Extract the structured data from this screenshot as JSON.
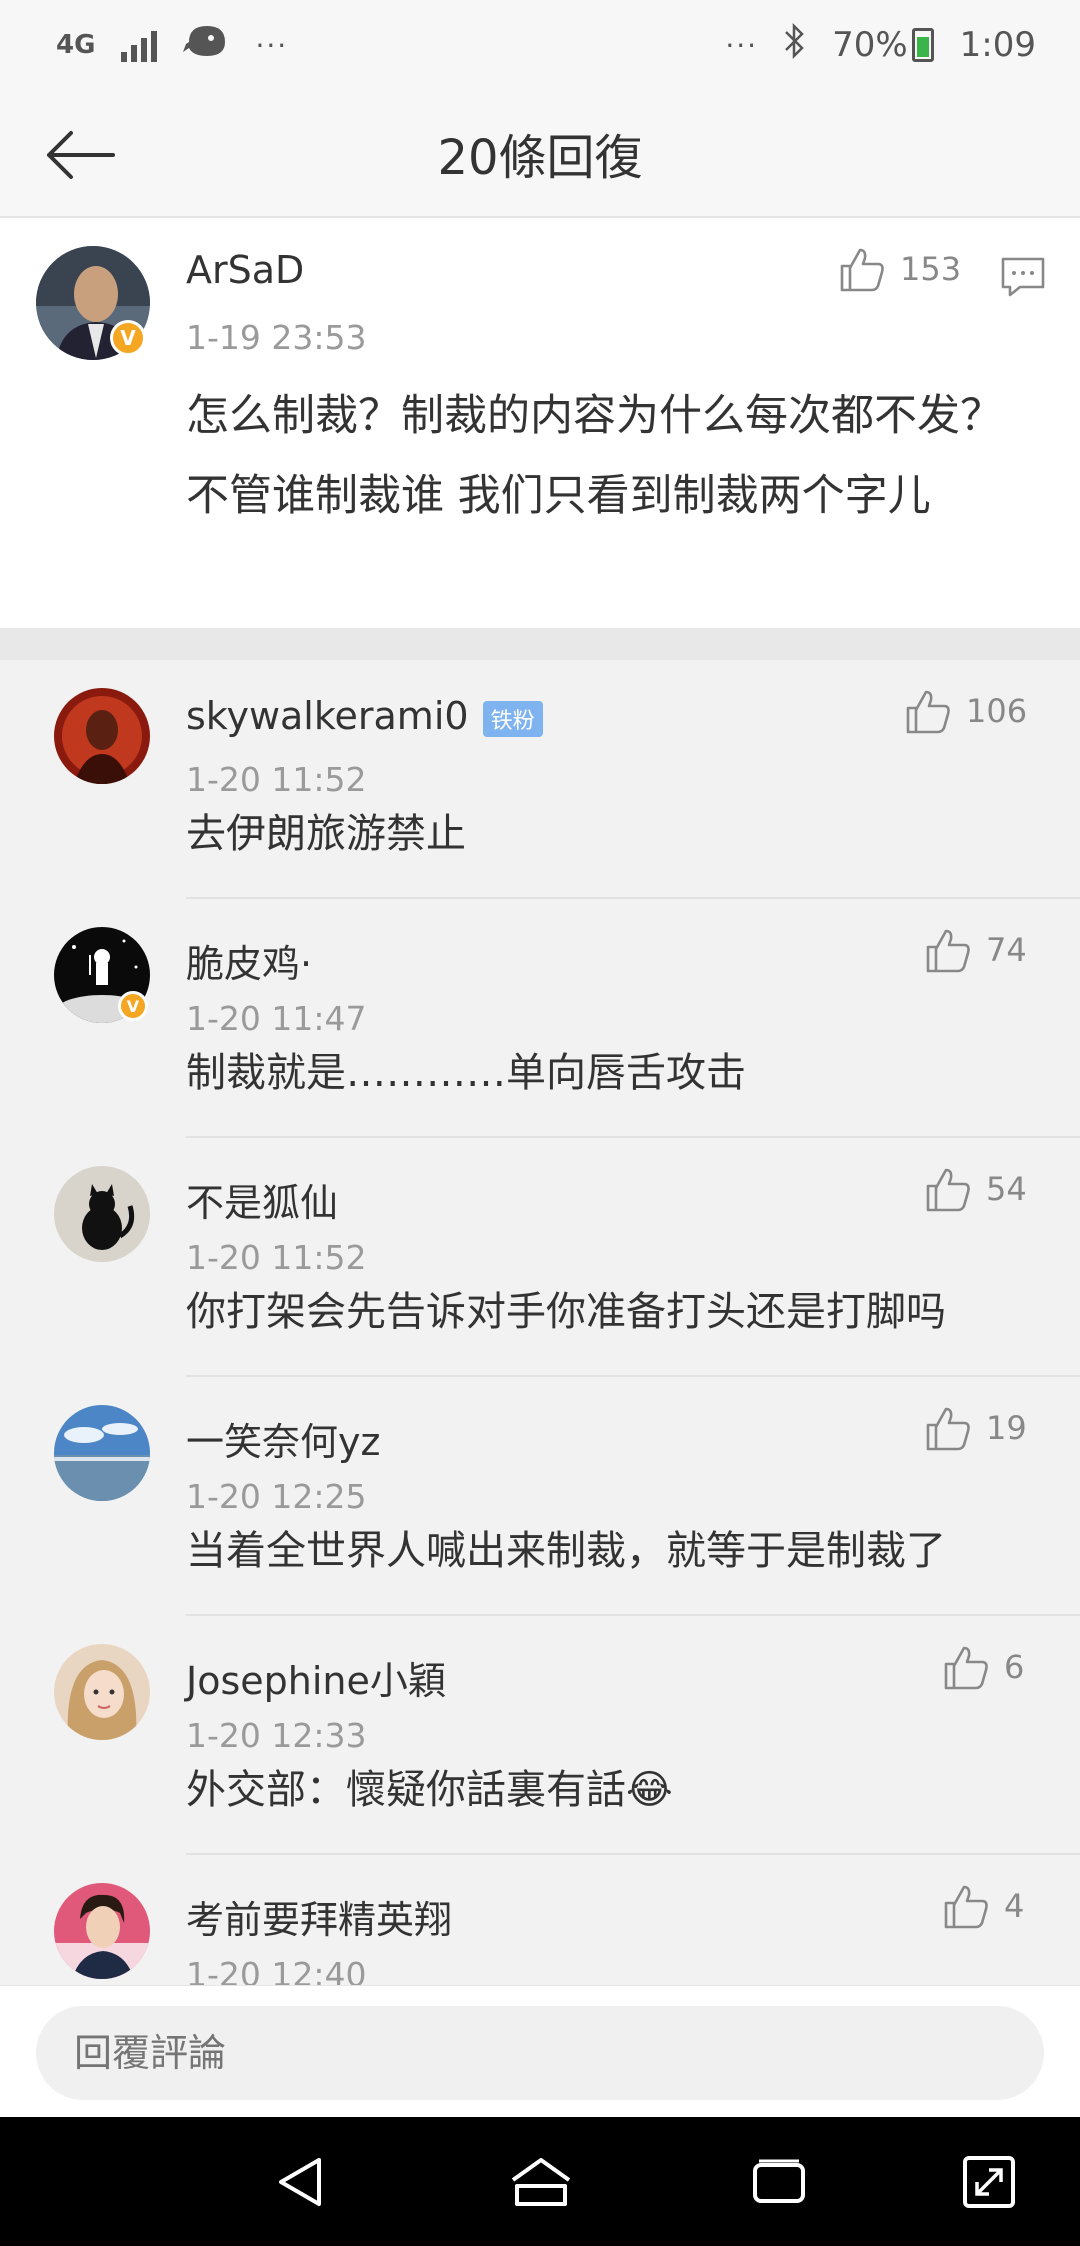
{
  "status_bar": {
    "network": "4G",
    "left_dots": "···",
    "right_dots": "···",
    "battery": "70%",
    "time": "1:09"
  },
  "header": {
    "title": "20條回復",
    "back_icon": "back-arrow-icon"
  },
  "main_post": {
    "username": "ArSaD",
    "time": "1-19 23:53",
    "likes": "153",
    "content": "怎么制裁？制裁的内容为什么每次都不发？不管谁制裁谁 我们只看到制裁两个字儿",
    "verified": true
  },
  "replies": [
    {
      "username": "skywalkerami0",
      "badge": "铁粉",
      "time": "1-20 11:52",
      "likes": "106",
      "content": "去伊朗旅游禁止"
    },
    {
      "username": "脆皮鸡·",
      "time": "1-20 11:47",
      "likes": "74",
      "content": "制裁就是…………单向唇舌攻击",
      "verified": true
    },
    {
      "username": "不是狐仙",
      "time": "1-20 11:52",
      "likes": "54",
      "content": "你打架会先告诉对手你准备打头还是打脚吗"
    },
    {
      "username": "一笑奈何yz",
      "time": "1-20 12:25",
      "likes": "19",
      "content": "当着全世界人喊出来制裁，就等于是制裁了"
    },
    {
      "username": "Josephine小穎",
      "time": "1-20 12:33",
      "likes": "6",
      "content": "外交部：懷疑你話裏有話😂"
    },
    {
      "username": "考前要拜精英翔",
      "time": "1-20 12:40",
      "likes": "4",
      "content": ""
    }
  ],
  "input": {
    "placeholder": "回覆評論"
  },
  "colors": {
    "verified": "#f5a623",
    "badge": "#7fb3f0",
    "background": "#f2f2f2"
  }
}
